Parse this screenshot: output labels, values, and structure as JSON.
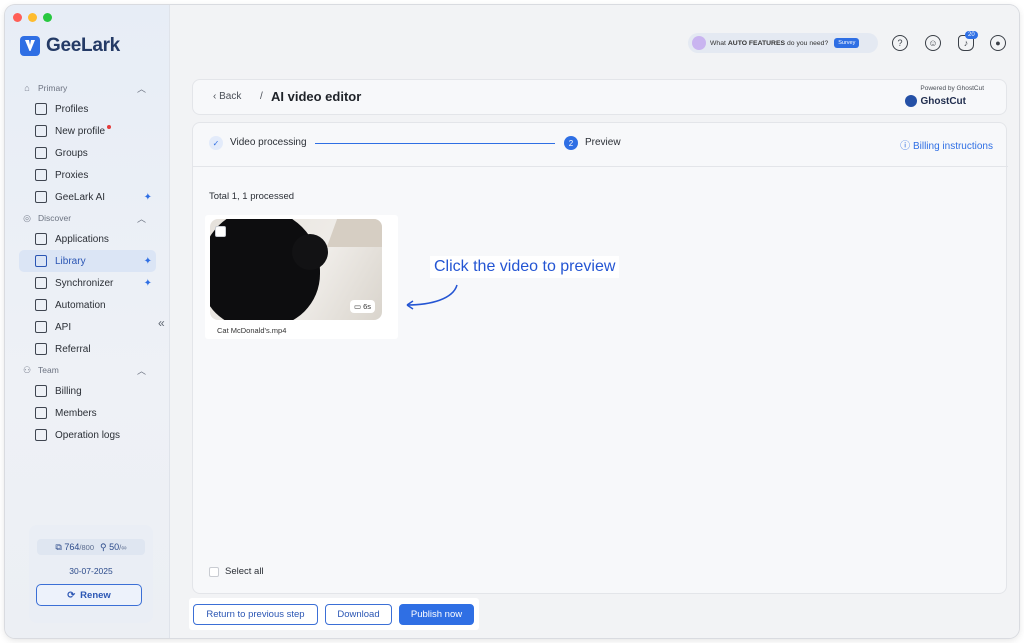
{
  "sidebar": {
    "brand": "GeeLark",
    "sections": [
      {
        "title": "Primary",
        "items": [
          {
            "label": "Profiles"
          },
          {
            "label": "New profile"
          },
          {
            "label": "Groups"
          },
          {
            "label": "Proxies"
          },
          {
            "label": "GeeLark AI"
          }
        ]
      },
      {
        "title": "Discover",
        "items": [
          {
            "label": "Applications"
          },
          {
            "label": "Library"
          },
          {
            "label": "Synchronizer"
          },
          {
            "label": "Automation"
          },
          {
            "label": "API"
          },
          {
            "label": "Referral"
          }
        ]
      },
      {
        "title": "Team",
        "items": [
          {
            "label": "Billing"
          },
          {
            "label": "Members"
          },
          {
            "label": "Operation logs"
          }
        ]
      }
    ],
    "stats": {
      "profiles": "764",
      "profiles_max": "/800",
      "members": "50",
      "members_max": "/∞",
      "date": "30-07-2025",
      "renew": "Renew"
    }
  },
  "topbar": {
    "banner_prefix": "What",
    "banner_bold": "AUTO FEATURES",
    "banner_suffix": "do you need?",
    "survey": "Survey",
    "notification_count": "20"
  },
  "header": {
    "back": "Back",
    "separator": "/",
    "title": "AI video editor",
    "powered_by": "Powered by GhostCut",
    "partner": "GhostCut"
  },
  "steps": [
    {
      "label": "Video processing"
    },
    {
      "number": "2",
      "label": "Preview"
    }
  ],
  "billing_link": "Billing instructions",
  "summary": "Total 1, 1 processed",
  "video": {
    "filename": "Cat McDonald's.mp4",
    "duration": "6s"
  },
  "callout": "Click the video to preview",
  "select_all": "Select all",
  "actions": {
    "previous": "Return to previous step",
    "download": "Download",
    "publish": "Publish now"
  },
  "colors": {
    "accent": "#2f6fe4",
    "callout_text": "#2455d3"
  }
}
